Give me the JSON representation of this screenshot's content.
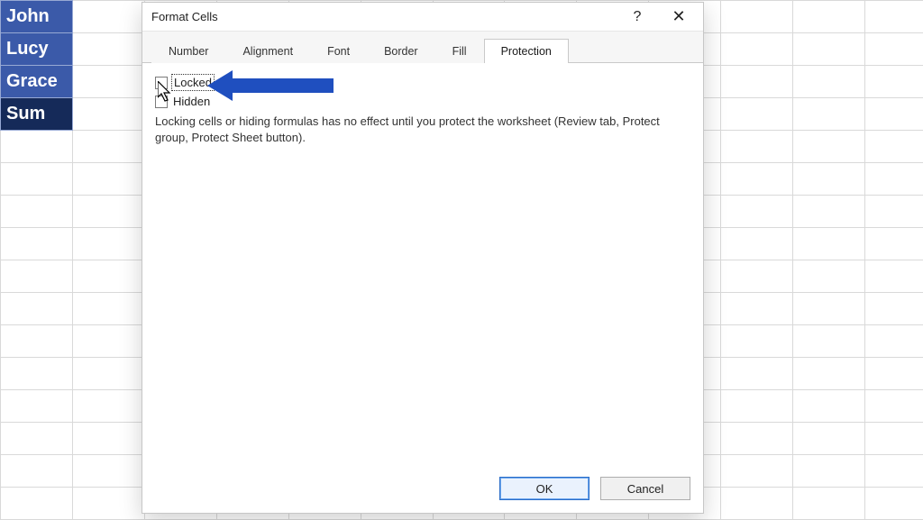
{
  "sheet": {
    "names": [
      "John",
      "Lucy",
      "Grace",
      "Sum"
    ]
  },
  "dialog": {
    "title": "Format Cells",
    "help": "?",
    "close": "✕",
    "tabs": [
      "Number",
      "Alignment",
      "Font",
      "Border",
      "Fill",
      "Protection"
    ],
    "active_tab_index": 5,
    "protection": {
      "locked_label": "Locked",
      "hidden_label": "Hidden",
      "description": "Locking cells or hiding formulas has no effect until you protect the worksheet (Review tab, Protect group, Protect Sheet button)."
    },
    "buttons": {
      "ok": "OK",
      "cancel": "Cancel"
    }
  },
  "colors": {
    "accent": "#1f4fbf",
    "blue_cell": "#3b5aa9",
    "blue_cell_dark": "#152a59"
  }
}
